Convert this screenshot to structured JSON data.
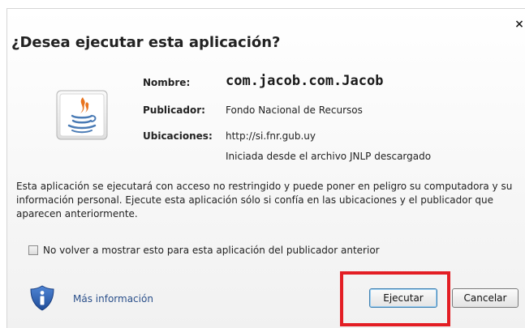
{
  "dialog": {
    "title": "¿Desea ejecutar esta aplicación?",
    "close_icon": "×"
  },
  "app_icon": "java-icon",
  "details": {
    "name_label": "Nombre:",
    "name_value": "com.jacob.com.Jacob",
    "publisher_label": "Publicador:",
    "publisher_value": "Fondo Nacional de Recursos",
    "locations_label": "Ubicaciones:",
    "location_url": "http://si.fnr.gub.uy",
    "location_note": "Iniciada desde el archivo JNLP descargado"
  },
  "warning_text": "Esta aplicación se ejecutará con acceso no restringido y puede poner en peligro su computadora y su información personal. Ejecute esta aplicación sólo si confía en las ubicaciones y el publicador que aparecen anteriormente.",
  "checkbox": {
    "label": "No volver a mostrar esto para esta aplicación del publicador anterior",
    "checked": false
  },
  "footer": {
    "info_icon": "info-shield-icon",
    "more_info_label": "Más información",
    "run_button_label": "Ejecutar",
    "cancel_button_label": "Cancelar"
  },
  "colors": {
    "highlight": "#e31e24",
    "link": "#2a4f8a",
    "info_shield": "#2d5fae"
  }
}
